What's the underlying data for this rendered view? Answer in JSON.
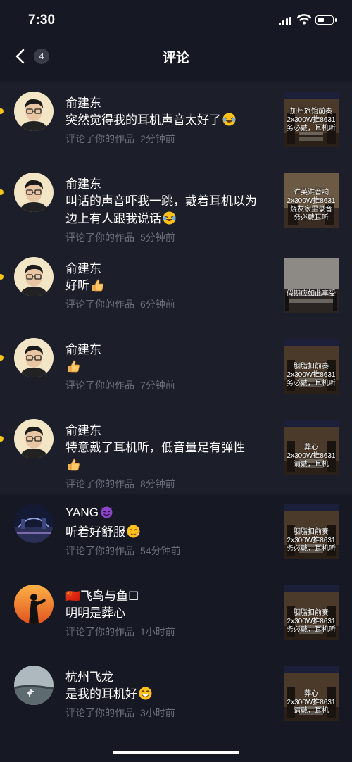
{
  "status": {
    "time": "7:30",
    "battery_level": 0.45
  },
  "header": {
    "title": "评论",
    "badge": "4",
    "back_icon": "chevron-left-icon"
  },
  "comments": [
    {
      "name": "俞建东",
      "lines": [
        "突然觉得我的耳机声音太好了"
      ],
      "emoji": "laughing-tears",
      "action": "评论了你的作品",
      "ago": "2分钟前",
      "unread": true,
      "avatar": "man-glasses",
      "thumb": {
        "style": "hall",
        "caption": [
          "加州旅馆前奏",
          "2x300W推8631",
          "务必戴，耳机听"
        ]
      }
    },
    {
      "name": "俞建东",
      "lines": [
        "叫话的声音吓我一跳，戴着耳机以为",
        "边上有人跟我说话"
      ],
      "emoji": "laughing-tears",
      "action": "评论了你的作品",
      "ago": "5分钟前",
      "unread": true,
      "avatar": "man-glasses",
      "thumb": {
        "style": "room",
        "caption": [
          "许英洪音响",
          "2x300W推8631",
          "烧友家里录音",
          "务必戴耳听"
        ]
      }
    },
    {
      "name": "俞建东",
      "lines": [
        "好听"
      ],
      "emoji": "thumbs-up",
      "action": "评论了你的作品",
      "ago": "6分钟前",
      "unread": true,
      "avatar": "man-glasses",
      "thumb": {
        "style": "rack",
        "caption": [
          "",
          "",
          "假期应如此享受"
        ]
      }
    },
    {
      "name": "俞建东",
      "lines": [
        ""
      ],
      "emoji": "thumbs-up",
      "action": "评论了你的作品",
      "ago": "7分钟前",
      "unread": true,
      "avatar": "man-glasses",
      "thumb": {
        "style": "hall",
        "caption": [
          "",
          "胭脂扣前奏",
          "2x300W推8631",
          "务必戴，耳机听"
        ]
      }
    },
    {
      "name": "俞建东",
      "lines": [
        "特意戴了耳机听，低音量足有弹性",
        ""
      ],
      "emoji": "thumbs-up",
      "emoji_line": 1,
      "action": "评论了你的作品",
      "ago": "8分钟前",
      "unread": true,
      "avatar": "man-glasses",
      "thumb": {
        "style": "hall",
        "caption": [
          "",
          "葬心",
          "2x300W推8631",
          "请戴，耳机"
        ]
      }
    },
    {
      "name": "YANG",
      "name_emoji": "devil",
      "lines": [
        "听着好舒服"
      ],
      "emoji": "relieved",
      "action": "评论了你的作品",
      "ago": "54分钟前",
      "unread": false,
      "avatar": "night-city",
      "thumb": {
        "style": "hall",
        "caption": [
          "",
          "胭脂扣前奏",
          "2x300W推8631",
          "务必戴，耳机听"
        ]
      }
    },
    {
      "name": "飞鸟与鱼",
      "name_prefix": "🇨🇳",
      "name_suffix": "☐",
      "lines": [
        "明明是葬心"
      ],
      "emoji": "",
      "action": "评论了你的作品",
      "ago": "1小时前",
      "unread": false,
      "avatar": "sunset-silhouette",
      "thumb": {
        "style": "hall",
        "caption": [
          "",
          "胭脂扣前奏",
          "2x300W推8631",
          "务必戴，耳机听"
        ]
      }
    },
    {
      "name": "杭州飞龙",
      "lines": [
        "是我的耳机好"
      ],
      "emoji": "grin",
      "action": "评论了你的作品",
      "ago": "3小时前",
      "unread": false,
      "avatar": "landscape-tiktok",
      "thumb": {
        "style": "hall",
        "caption": [
          "",
          "葬心",
          "2x300W推8631",
          "请戴，耳机"
        ]
      }
    }
  ]
}
